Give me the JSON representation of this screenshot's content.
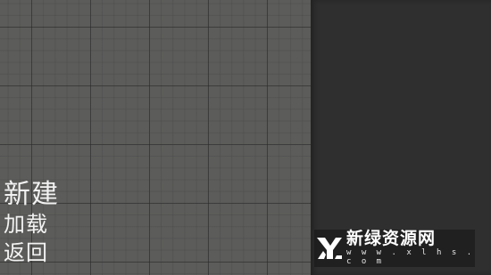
{
  "menu": {
    "new_label": "新建",
    "load_label": "加载",
    "back_label": "返回"
  },
  "watermark": {
    "title": "新绿资源网",
    "url": "w w w . x l h s . c o m",
    "logo_icon": "xl-logo-icon"
  },
  "colors": {
    "canvas_bg": "#5c5c5a",
    "panel_bg": "#2f2f2f",
    "text": "#f2f2f2"
  }
}
